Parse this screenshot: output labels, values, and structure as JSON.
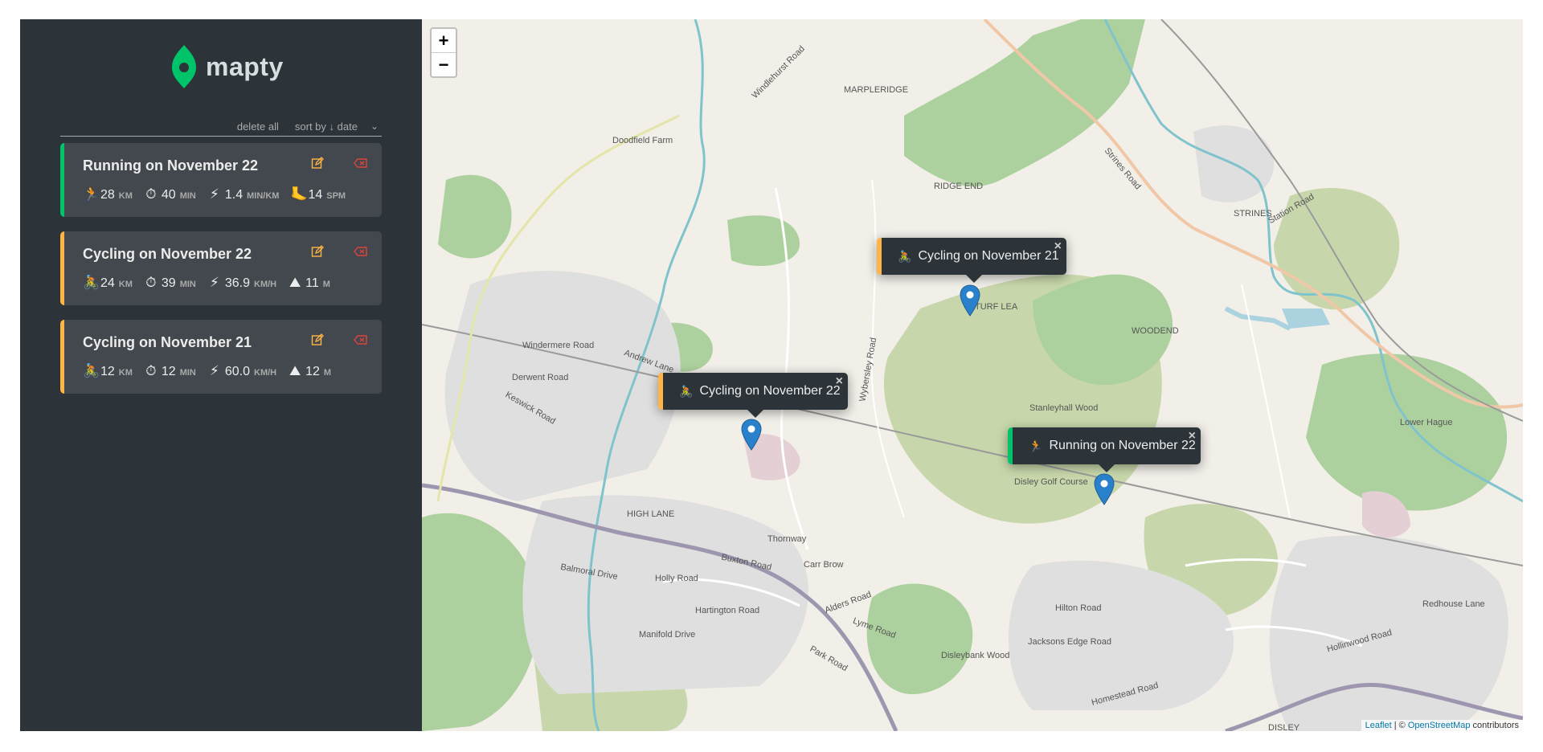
{
  "app": {
    "name": "mapty"
  },
  "controls": {
    "delete_all": "delete all",
    "sort_label": "sort by ↓ date"
  },
  "workouts": [
    {
      "title": "Running on November 22",
      "type": "running",
      "details": [
        {
          "icon": "🏃",
          "value": "28",
          "unit": "km"
        },
        {
          "icon": "⏱",
          "value": "40",
          "unit": "min"
        },
        {
          "icon": "⚡",
          "value": "1.4",
          "unit": "min/km"
        },
        {
          "icon": "🦶",
          "value": "14",
          "unit": "spm"
        }
      ]
    },
    {
      "title": "Cycling on November 22",
      "type": "cycling",
      "details": [
        {
          "icon": "🚴",
          "value": "24",
          "unit": "km"
        },
        {
          "icon": "⏱",
          "value": "39",
          "unit": "min"
        },
        {
          "icon": "⚡",
          "value": "36.9",
          "unit": "km/h"
        },
        {
          "icon": "⛰",
          "value": "11",
          "unit": "m"
        }
      ]
    },
    {
      "title": "Cycling on November 21",
      "type": "cycling",
      "details": [
        {
          "icon": "🚴",
          "value": "12",
          "unit": "km"
        },
        {
          "icon": "⏱",
          "value": "12",
          "unit": "min"
        },
        {
          "icon": "⚡",
          "value": "60.0",
          "unit": "km/h"
        },
        {
          "icon": "⛰",
          "value": "12",
          "unit": "m"
        }
      ]
    }
  ],
  "map": {
    "zoom_in": "+",
    "zoom_out": "−",
    "popups": [
      {
        "icon": "🚴",
        "label": "Cycling on November 21",
        "close": "×"
      },
      {
        "icon": "🚴",
        "label": "Cycling on November 22",
        "close": "×"
      },
      {
        "icon": "🏃",
        "label": "Running on November 22",
        "close": "×"
      }
    ],
    "attribution": {
      "leaflet": "Leaflet",
      "sep": " | © ",
      "osm": "OpenStreetMap",
      "contributors": " contributors"
    },
    "place_labels": [
      "MARPLERIDGE",
      "RIDGE END",
      "TURF LEA",
      "WOODEND",
      "STRINES",
      "HIGH LANE",
      "Stanleyhall Wood",
      "Disley Golf Course",
      "Disleybank Wood",
      "DISLEY",
      "Doodfield Farm",
      "Buxton Road",
      "Thornway",
      "Carr Brow",
      "Strines Road",
      "Station Road",
      "Hilton Road",
      "Jacksons Edge Road",
      "Lower Hague",
      "Homestead Road",
      "Hollinwood Road",
      "Redhouse Lane",
      "Windlehurst Road",
      "Wybersley Road",
      "Andrew Lane",
      "Holly Road",
      "Hartington Road",
      "Balmoral Drive",
      "Derwent Road",
      "Keswick Road",
      "Windermere Road",
      "Lyme Road",
      "Park Road",
      "Alders Road",
      "Manifold Drive"
    ]
  },
  "colors": {
    "sidebar": "#2d3439",
    "card": "#42484d",
    "running": "#00c46a",
    "cycling": "#ffb545",
    "delete": "#e0433a"
  }
}
